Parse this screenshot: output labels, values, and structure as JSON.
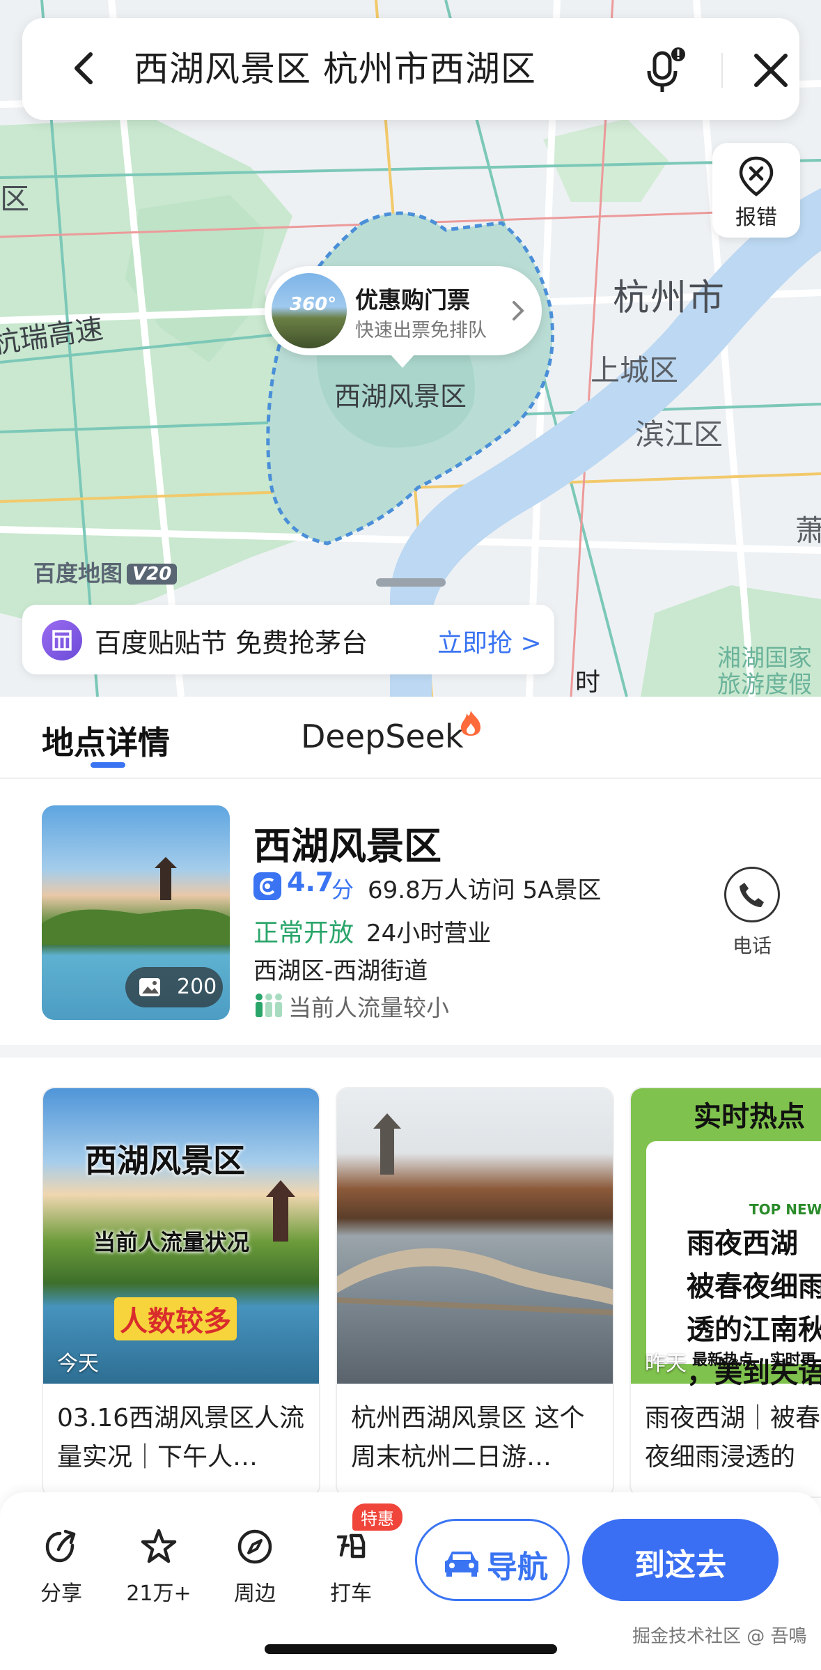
{
  "search": {
    "query": "西湖风景区 杭州市西湖区"
  },
  "map": {
    "report_label": "报错",
    "labels": {
      "city": "杭州市",
      "district_1": "上城区",
      "district_2": "滨江区",
      "road": "杭瑞高速",
      "edge_left": "区",
      "edge_right": "萧",
      "edge_bottom": "时",
      "scenic_1": "湘湖国家",
      "scenic_2": "旅游度假"
    },
    "ticket_bubble": {
      "badge": "360°",
      "title": "优惠购门票",
      "subtitle": "快速出票免排队"
    },
    "poi_label": "西湖风景区",
    "logo": "百度地图",
    "logo_version": "V20",
    "promo": {
      "text": "百度贴贴节 免费抢茅台",
      "action": "立即抢 >"
    }
  },
  "tabs": {
    "detail": "地点详情",
    "deepseek": "DeepSeek"
  },
  "poi": {
    "name": "西湖风景区",
    "photo_count": "200",
    "rating": "4.7",
    "rating_unit": "分",
    "visits_and_level": "69.8万人访问  5A景区",
    "open_status": "正常开放",
    "hours": "24小时营业",
    "address": "西湖区-西湖街道",
    "crowd": "当前人流量较小",
    "phone_label": "电话"
  },
  "cards": [
    {
      "overlay_title": "西湖风景区",
      "overlay_sub": "当前人流量状况",
      "overlay_tag": "人数较多",
      "date": "今天",
      "title": "03.16西湖风景区人流量实况｜下午人…"
    },
    {
      "date": "",
      "title": "杭州西湖风景区 这个周末杭州二日游…"
    },
    {
      "overlay_top": "实时热点",
      "overlay_news": "TOP NEWS",
      "overlay_lines": "雨夜西湖\n被春夜细雨\n透的江南秋\n，美到失语",
      "overlay_strip": "最新热点 · 实时更",
      "date": "昨天",
      "title": "雨夜西湖｜被春夜细雨浸透的江…"
    }
  ],
  "bottom_bar": {
    "share": "分享",
    "favorite": "21万+",
    "nearby": "周边",
    "taxi": "打车",
    "taxi_badge": "特惠",
    "navigate": "导航",
    "go_here": "到这去"
  },
  "watermark": "掘金技术社区 @ 吾鳴"
}
